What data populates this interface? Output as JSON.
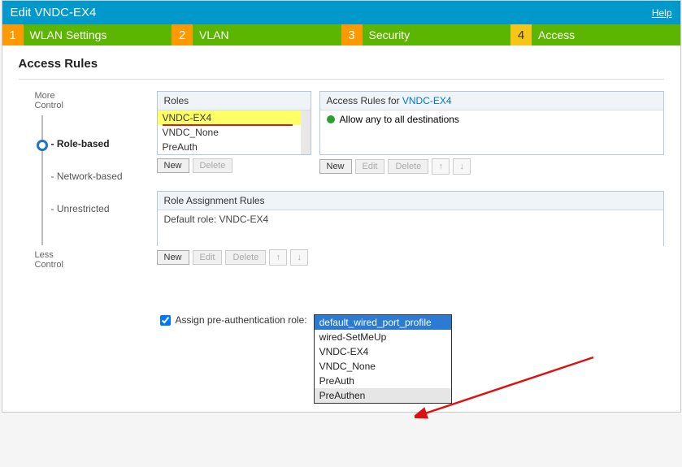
{
  "title": "Edit VNDC-EX4",
  "help": "Help",
  "tabs": [
    {
      "num": "1",
      "label": "WLAN Settings"
    },
    {
      "num": "2",
      "label": "VLAN"
    },
    {
      "num": "3",
      "label": "Security"
    },
    {
      "num": "4",
      "label": "Access"
    }
  ],
  "section": "Access Rules",
  "slider": {
    "top": "More\nControl",
    "bottom": "Less\nControl",
    "options": [
      "Role-based",
      "Network-based",
      "Unrestricted"
    ],
    "selected": "Role-based"
  },
  "roles": {
    "header": "Roles",
    "items": [
      "VNDC-EX4",
      "VNDC_None",
      "PreAuth"
    ],
    "selected": "VNDC-EX4",
    "buttons": {
      "new": "New",
      "delete": "Delete"
    }
  },
  "rules": {
    "header_prefix": "Access Rules for ",
    "header_link": "VNDC-EX4",
    "line": "Allow any to all destinations",
    "buttons": {
      "new": "New",
      "edit": "Edit",
      "delete": "Delete"
    }
  },
  "assignment": {
    "header": "Role Assignment Rules",
    "body": "Default role: VNDC-EX4",
    "buttons": {
      "new": "New",
      "edit": "Edit",
      "delete": "Delete"
    }
  },
  "preauth": {
    "label": "Assign pre-authentication role:",
    "checked": true,
    "options": [
      "default_wired_port_profile",
      "wired-SetMeUp",
      "VNDC-EX4",
      "VNDC_None",
      "PreAuth",
      "PreAuthen"
    ],
    "highlighted": "default_wired_port_profile",
    "hover": "PreAuthen"
  }
}
